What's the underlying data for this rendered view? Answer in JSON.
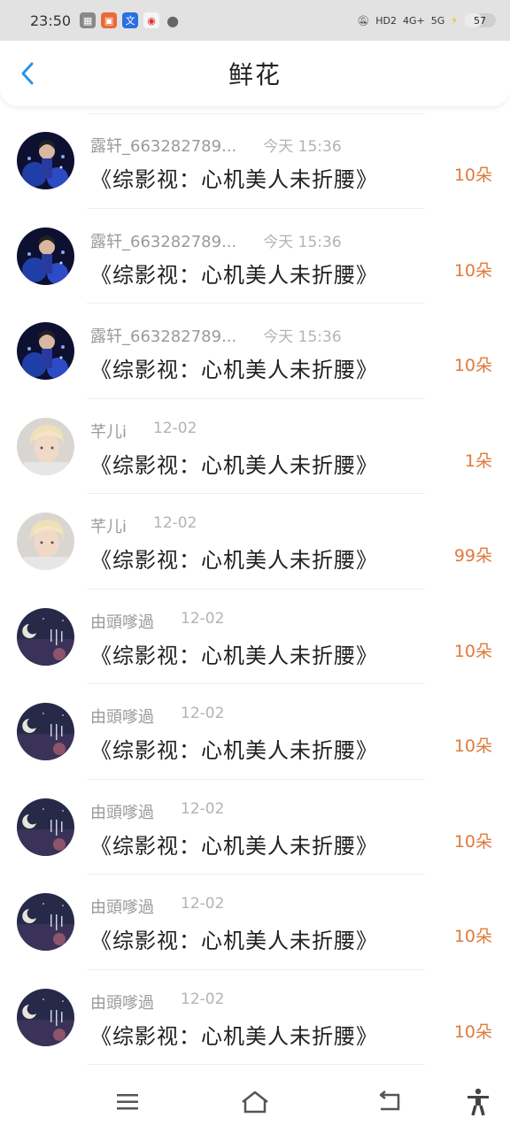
{
  "status": {
    "time": "23:50",
    "battery": "57",
    "network_hd": "HD2",
    "network_4g": "4G+",
    "network_5g": "5G"
  },
  "header": {
    "title": "鲜花"
  },
  "colors": {
    "accent": "#2a93e8",
    "count": "#e07a3b"
  },
  "rows": [
    {
      "user": "露轩_663282789...",
      "time": "今天 15:36",
      "book": "《综影视：心机美人未折腰》",
      "count": "10朵",
      "avatar": "performer-avatar"
    },
    {
      "user": "露轩_663282789...",
      "time": "今天 15:36",
      "book": "《综影视：心机美人未折腰》",
      "count": "10朵",
      "avatar": "performer-avatar"
    },
    {
      "user": "露轩_663282789...",
      "time": "今天 15:36",
      "book": "《综影视：心机美人未折腰》",
      "count": "10朵",
      "avatar": "performer-avatar"
    },
    {
      "user": "芊儿i",
      "time": "12-02",
      "book": "《综影视：心机美人未折腰》",
      "count": "1朵",
      "avatar": "blonde-avatar"
    },
    {
      "user": "芊儿i",
      "time": "12-02",
      "book": "《综影视：心机美人未折腰》",
      "count": "99朵",
      "avatar": "blonde-avatar"
    },
    {
      "user": "由頭嗲過",
      "time": "12-02",
      "book": "《综影视：心机美人未折腰》",
      "count": "10朵",
      "avatar": "moon-avatar"
    },
    {
      "user": "由頭嗲過",
      "time": "12-02",
      "book": "《综影视：心机美人未折腰》",
      "count": "10朵",
      "avatar": "moon-avatar"
    },
    {
      "user": "由頭嗲過",
      "time": "12-02",
      "book": "《综影视：心机美人未折腰》",
      "count": "10朵",
      "avatar": "moon-avatar"
    },
    {
      "user": "由頭嗲過",
      "time": "12-02",
      "book": "《综影视：心机美人未折腰》",
      "count": "10朵",
      "avatar": "moon-avatar"
    },
    {
      "user": "由頭嗲過",
      "time": "12-02",
      "book": "《综影视：心机美人未折腰》",
      "count": "10朵",
      "avatar": "moon-avatar"
    }
  ]
}
